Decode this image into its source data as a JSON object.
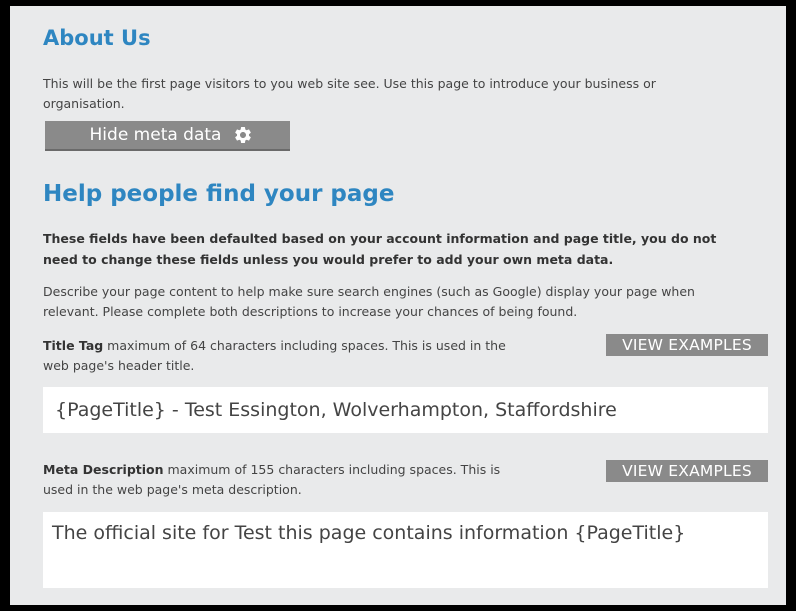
{
  "about": {
    "title": "About Us",
    "text": "This will be the first page visitors to you web site see. Use this page to introduce your business or organisation."
  },
  "meta_toggle": {
    "label": "Hide meta data",
    "icon": "gear-icon"
  },
  "help": {
    "title": "Help people find your page",
    "bold_text": "These fields have been defaulted based on your account information and page title, you do not need to change these fields unless you would prefer to add your own meta data.",
    "description": "Describe your page content to help make sure search engines (such as Google) display your page when relevant. Please complete both descriptions to increase your chances of being found."
  },
  "title_tag": {
    "label": "Title Tag",
    "hint": " maximum of 64 characters including spaces. This is used in the web page's header title.",
    "button": "VIEW EXAMPLES",
    "value": "{PageTitle} - Test Essington, Wolverhampton, Staffordshire"
  },
  "meta_description": {
    "label": "Meta Description",
    "hint": " maximum of 155 characters including spaces. This is used in the web page's meta description.",
    "button": "VIEW EXAMPLES",
    "value": "The official site for Test this page contains information {PageTitle}"
  },
  "colors": {
    "heading": "#2e86c1",
    "button": "#8a8a8a",
    "background": "#e9eaeb"
  }
}
